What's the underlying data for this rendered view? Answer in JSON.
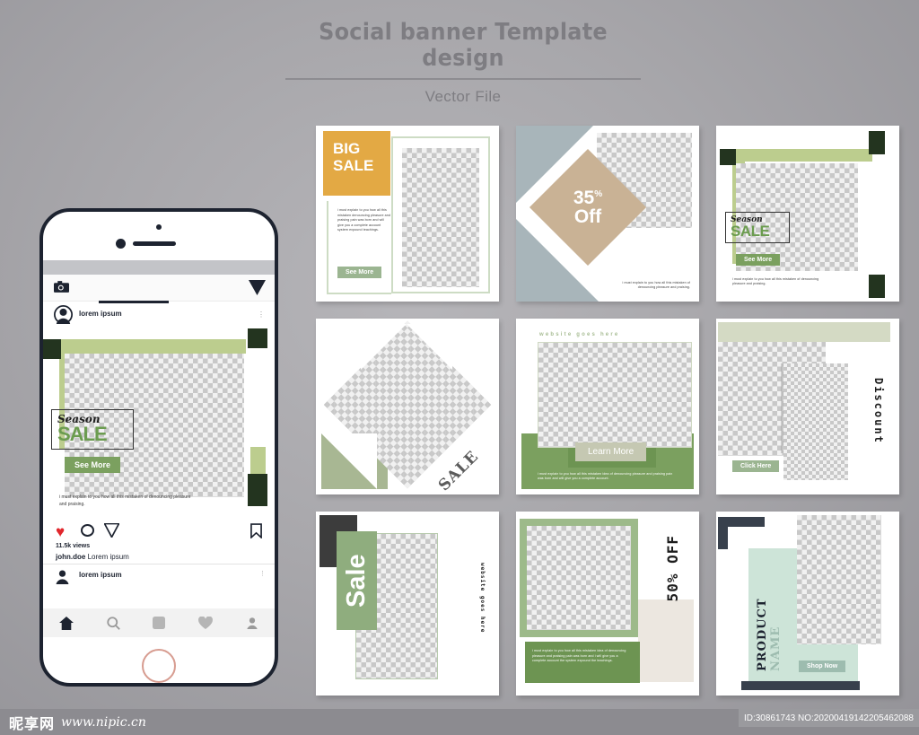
{
  "header": {
    "title": "Social banner Template design",
    "subtitle": "Vector File"
  },
  "phone": {
    "app_bar": {
      "camera_icon": "camera-icon",
      "send_icon": "paper-plane-icon"
    },
    "post": {
      "username": "lorem ipsum",
      "menu_icon": "more-options-icon",
      "like_icon": "heart-icon",
      "comment_icon": "comment-icon",
      "share_icon": "paper-plane-icon",
      "save_icon": "bookmark-icon",
      "views": "11.5k views",
      "caption_user": "john.doe",
      "caption_text": "Lorem ipsum",
      "body_text": "i must explain to you how all this mistaken of denouncing pleasure and praising.",
      "label_top": "Season",
      "label_bottom": "SALE",
      "button": "See More"
    },
    "next_post": {
      "username": "lorem ipsum",
      "menu_icon": "more-options-icon"
    },
    "tabbar": [
      {
        "name": "home-icon"
      },
      {
        "name": "search-icon"
      },
      {
        "name": "reels-icon"
      },
      {
        "name": "heart-icon"
      },
      {
        "name": "profile-icon"
      }
    ]
  },
  "cards": {
    "c1": {
      "title_line1": "BIG",
      "title_line2": "SALE",
      "body": "i must explain to you how all this mistaken denouncing pleasure and praising pain was born and will give you a complete account system expound teachings.",
      "button": "See More"
    },
    "c2": {
      "percent": "35",
      "percent_symbol": "%",
      "off": "Off",
      "body": "i must explain to you how all this mistaken of denouncing pleasure and praising."
    },
    "c3": {
      "label_top": "Season",
      "label_bottom": "SALE",
      "button": "See More",
      "body": "i must explain to you how all this mistaken of denouncing pleasure and praising."
    },
    "c4": {
      "sale": "SALE"
    },
    "c5": {
      "website": "website goes here",
      "button": "Learn More",
      "body": "i must explain to you how all this mistaken idea of denouncing pleasure and praising pain was born and will give you a complete account."
    },
    "c6": {
      "discount": "Discount",
      "button": "Click Here"
    },
    "c7": {
      "sale": "Sale",
      "website": "website goes here"
    },
    "c8": {
      "off": "50% OFF",
      "body": "i must explain to you how all this mistaken idea of denouncing pleasure and praising pain was born and i will give you a complete account the system expound the teachings."
    },
    "c9": {
      "product": "PRODUCT",
      "name": "NAME",
      "button": "Shop Now"
    }
  },
  "watermark": {
    "brand_cn": "昵享网",
    "url": "www.nipic.cn",
    "id_text": "ID:30861743 NO:20200419142205462088"
  },
  "colors": {
    "green": "#6b9c4f",
    "green_btn": "#7ba05f",
    "orange": "#e3a944",
    "tan": "#c9b295",
    "blue_gray": "#a8b5ba",
    "light_green": "#bccd8e",
    "dark_green": "#23341f",
    "mint": "#cde4d8",
    "sage": "#a8b793",
    "dark_navy": "#38404c"
  }
}
